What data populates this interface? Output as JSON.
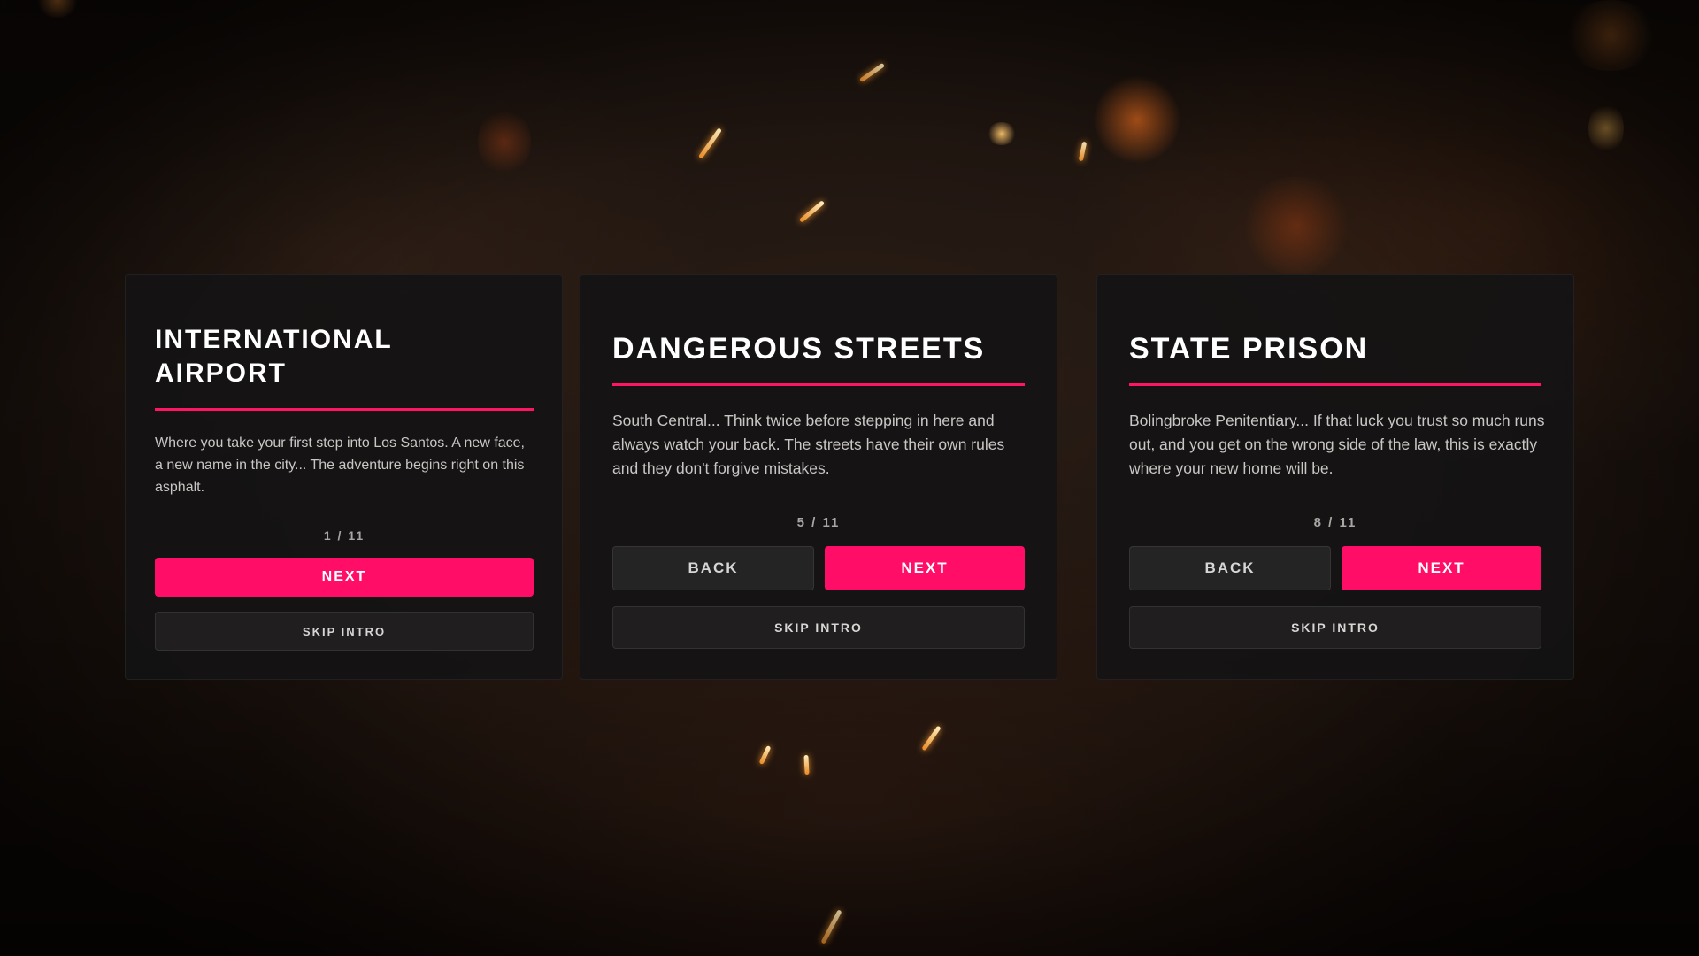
{
  "cards": [
    {
      "title": "INTERNATIONAL\nAIRPORT",
      "description": "Where you take your first step into Los Santos. A new face, a new name in the city... The adventure begins right on this asphalt.",
      "counter": "1 / 11",
      "next_label": "NEXT",
      "skip_label": "SKIP INTRO"
    },
    {
      "title": "DANGEROUS STREETS",
      "description": "South Central... Think twice before stepping in here and always watch your back. The streets have their own rules and they don't forgive mistakes.",
      "counter": "5 / 11",
      "back_label": "BACK",
      "next_label": "NEXT",
      "skip_label": "SKIP INTRO"
    },
    {
      "title": "STATE PRISON",
      "description": "Bolingbroke Penitentiary... If that luck you trust so much runs out, and you get on the wrong side of the law, this is exactly where your new home will be.",
      "counter": "8 / 11",
      "back_label": "BACK",
      "next_label": "NEXT",
      "skip_label": "SKIP INTRO"
    }
  ],
  "colors": {
    "accent": "#ff0d66",
    "card_background": "#141314",
    "text": "#ffffff"
  }
}
